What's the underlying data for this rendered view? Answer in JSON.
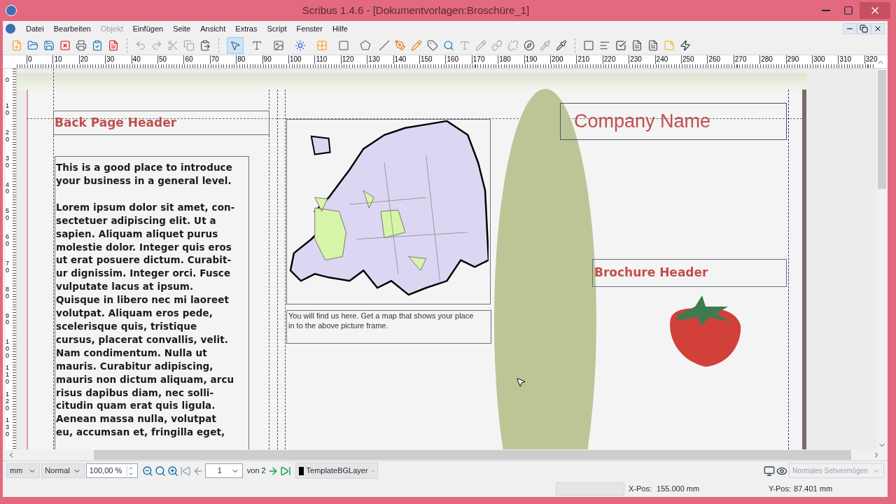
{
  "window": {
    "title": "Scribus 1.4.6 - [Dokumentvorlagen:Broschüre_1]"
  },
  "menu": [
    {
      "label": "Datei",
      "disabled": false
    },
    {
      "label": "Bearbeiten",
      "disabled": false
    },
    {
      "label": "Objekt",
      "disabled": true
    },
    {
      "label": "Einfügen",
      "disabled": false
    },
    {
      "label": "Seite",
      "disabled": false
    },
    {
      "label": "Ansicht",
      "disabled": false
    },
    {
      "label": "Extras",
      "disabled": false
    },
    {
      "label": "Script",
      "disabled": false
    },
    {
      "label": "Fenster",
      "disabled": false
    },
    {
      "label": "Hilfe",
      "disabled": false
    }
  ],
  "mode_tools": [
    {
      "selected": true
    },
    {
      "selected": false
    },
    {
      "selected": false
    },
    {
      "selected": false
    },
    {
      "selected": false
    },
    {
      "selected": false
    },
    {
      "selected": false
    }
  ],
  "ruler": {
    "horizontal": [
      "0",
      "10",
      "20",
      "30",
      "40",
      "50",
      "60",
      "70",
      "80",
      "90",
      "100",
      "110",
      "120",
      "130",
      "140",
      "150",
      "160",
      "170",
      "180",
      "190",
      "200",
      "210",
      "220",
      "230",
      "240",
      "250",
      "260",
      "270",
      "280",
      "290",
      "300",
      "310",
      "320"
    ],
    "vertical": [
      "0",
      "10",
      "20",
      "30",
      "40",
      "50",
      "60",
      "70",
      "80",
      "90",
      "100",
      "110",
      "120",
      "130"
    ]
  },
  "page": {
    "back_header": "Back Page Header",
    "body": [
      "This is a good place to introduce\nyour business in a general level.",
      "Lorem ipsum dolor sit amet, con-\nsectetuer adipiscing elit. Ut a\nsapien. Aliquam aliquet purus\nmolestie dolor. Integer quis eros\nut erat posuere dictum. Curabit-\nur dignissim. Integer orci. Fusce\nvulputate lacus at ipsum.\nQuisque in libero nec mi laoreet\nvolutpat. Aliquam eros pede,\nscelerisque quis, tristique\ncursus, placerat convallis, velit.\nNam condimentum. Nulla ut\nmauris. Curabitur adipiscing,\nmauris non dictum aliquam, arcu\nrisus dapibus diam, nec solli-\ncitudin quam erat quis ligula.\nAenean massa nulla, volutpat\neu, accumsan et, fringilla eget,"
    ],
    "map_caption": "You will find us here. Get a map that shows your place\nin to the above picture frame.",
    "company_name": "Company Name",
    "brochure_header": "Brochure Header"
  },
  "bottom_bar": {
    "unit": "mm",
    "quality": "Normal",
    "zoom": "100,00 %",
    "page_number": "1",
    "page_count": "von 2",
    "layer": "TemplateBGLayer",
    "vision": "Normales Sehvermögen"
  },
  "status_bar": {
    "x_label": "X-Pos:",
    "x_value": "155.000 mm",
    "y_label": "Y-Pos:",
    "y_value": "87.401 mm"
  }
}
